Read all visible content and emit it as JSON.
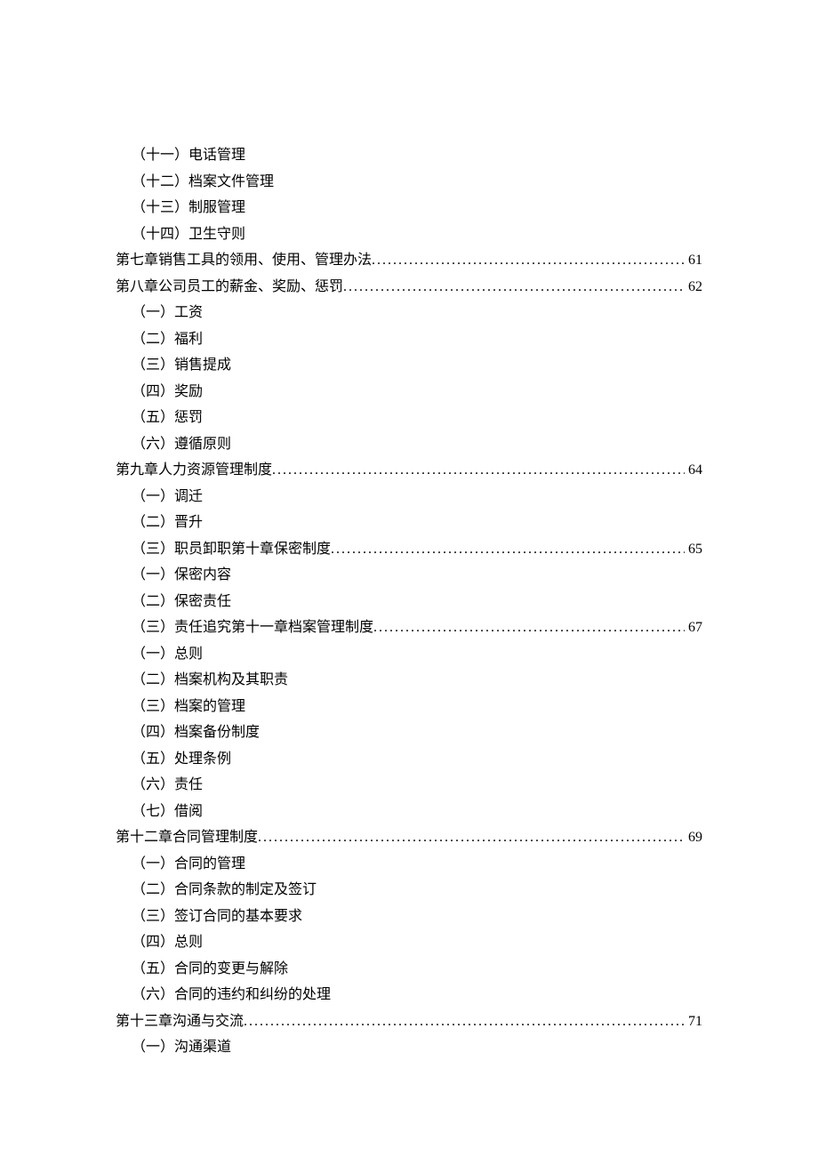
{
  "toc": [
    {
      "text": "（十一）电话管理",
      "indent": true,
      "page": null
    },
    {
      "text": "（十二）档案文件管理",
      "indent": true,
      "page": null
    },
    {
      "text": "（十三）制服管理",
      "indent": true,
      "page": null
    },
    {
      "text": "（十四）卫生守则",
      "indent": true,
      "page": null
    },
    {
      "text": "第七章销售工具的领用、使用、管理办法",
      "indent": false,
      "page": "61"
    },
    {
      "text": "第八章公司员工的薪金、奖励、惩罚",
      "indent": false,
      "page": "62"
    },
    {
      "text": "（一）工资",
      "indent": true,
      "page": null
    },
    {
      "text": "（二）福利",
      "indent": true,
      "page": null
    },
    {
      "text": "（三）销售提成",
      "indent": true,
      "page": null
    },
    {
      "text": "（四）奖励",
      "indent": true,
      "page": null
    },
    {
      "text": "（五）惩罚",
      "indent": true,
      "page": null
    },
    {
      "text": "（六）遵循原则",
      "indent": true,
      "page": null
    },
    {
      "text": "第九章人力资源管理制度",
      "indent": false,
      "page": "64"
    },
    {
      "text": "（一）调迁",
      "indent": true,
      "page": null
    },
    {
      "text": "（二）晋升",
      "indent": true,
      "page": null
    },
    {
      "text": "（三）职员卸职第十章保密制度",
      "indent": true,
      "page": "65"
    },
    {
      "text": "（一）保密内容",
      "indent": true,
      "page": null
    },
    {
      "text": "（二）保密责任",
      "indent": true,
      "page": null
    },
    {
      "text": "（三）责任追究第十一章档案管理制度",
      "indent": true,
      "page": "67"
    },
    {
      "text": "（一）总则",
      "indent": true,
      "page": null
    },
    {
      "text": "（二）档案机构及其职责",
      "indent": true,
      "page": null
    },
    {
      "text": "（三）档案的管理",
      "indent": true,
      "page": null
    },
    {
      "text": "（四）档案备份制度",
      "indent": true,
      "page": null
    },
    {
      "text": "（五）处理条例",
      "indent": true,
      "page": null
    },
    {
      "text": "（六）责任",
      "indent": true,
      "page": null
    },
    {
      "text": "（七）借阅",
      "indent": true,
      "page": null
    },
    {
      "text": "第十二章合同管理制度",
      "indent": false,
      "page": "69"
    },
    {
      "text": "（一）合同的管理",
      "indent": true,
      "page": null
    },
    {
      "text": "（二）合同条款的制定及签订",
      "indent": true,
      "page": null
    },
    {
      "text": "（三）签订合同的基本要求",
      "indent": true,
      "page": null
    },
    {
      "text": "（四）总则",
      "indent": true,
      "page": null
    },
    {
      "text": "（五）合同的变更与解除",
      "indent": true,
      "page": null
    },
    {
      "text": "（六）合同的违约和纠纷的处理",
      "indent": true,
      "page": null
    },
    {
      "text": "第十三章沟通与交流",
      "indent": false,
      "page": "71"
    },
    {
      "text": "（一）沟通渠道",
      "indent": true,
      "page": null
    }
  ]
}
